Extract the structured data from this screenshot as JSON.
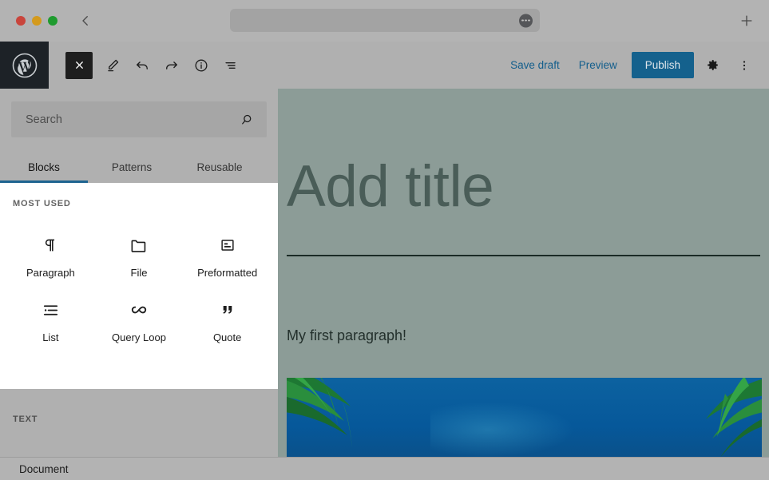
{
  "browser": {
    "traffic_lights": [
      "close",
      "minimize",
      "zoom"
    ],
    "back_label": "Back",
    "url_value": "",
    "url_placeholder": "",
    "menu_icon": "ellipsis-icon",
    "new_tab_label": "New Tab"
  },
  "editor_header": {
    "logo_name": "wordpress-logo",
    "tools": [
      {
        "name": "close-inserter-button",
        "icon": "close-icon",
        "label": "Close block inserter"
      },
      {
        "name": "edit-tool-button",
        "icon": "pencil-icon",
        "label": "Edit"
      },
      {
        "name": "undo-button",
        "icon": "undo-icon",
        "label": "Undo"
      },
      {
        "name": "redo-button",
        "icon": "redo-icon",
        "label": "Redo"
      },
      {
        "name": "details-button",
        "icon": "info-icon",
        "label": "Details"
      },
      {
        "name": "list-view-button",
        "icon": "list-view-icon",
        "label": "List view"
      }
    ],
    "save_draft_label": "Save draft",
    "preview_label": "Preview",
    "publish_label": "Publish",
    "settings_icon": "gear-icon",
    "more_icon": "ellipsis-vertical-icon",
    "publish_color": "#14618d",
    "link_color": "#135e8c"
  },
  "inserter": {
    "search": {
      "value": "",
      "placeholder": "Search",
      "icon": "search-icon"
    },
    "tabs": [
      {
        "label": "Blocks",
        "active": true
      },
      {
        "label": "Patterns",
        "active": false
      },
      {
        "label": "Reusable",
        "active": false
      }
    ],
    "active_tab_color": "#1d6490",
    "most_used_label": "MOST USED",
    "blocks": [
      {
        "label": "Paragraph",
        "icon": "paragraph-icon"
      },
      {
        "label": "File",
        "icon": "folder-icon"
      },
      {
        "label": "Preformatted",
        "icon": "preformatted-icon"
      },
      {
        "label": "List",
        "icon": "list-icon"
      },
      {
        "label": "Query Loop",
        "icon": "loop-icon"
      },
      {
        "label": "Quote",
        "icon": "quote-icon"
      }
    ],
    "text_label": "TEXT"
  },
  "canvas": {
    "title_placeholder": "Add title",
    "paragraph_text": "My first paragraph!",
    "background_color": "#8c9c97",
    "image_block_alt": "Palm trees against a blue sky"
  },
  "status_bar": {
    "document_label": "Document"
  }
}
